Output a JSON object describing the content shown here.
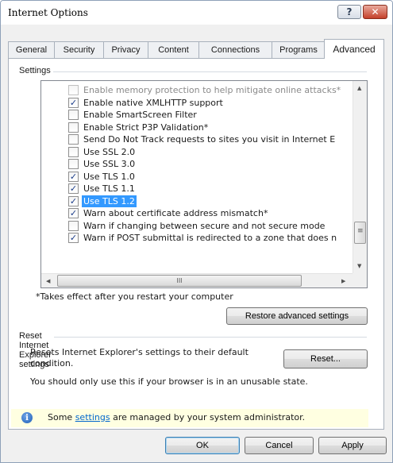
{
  "window": {
    "title": "Internet Options",
    "help_glyph": "?",
    "close_glyph": "✕"
  },
  "tabs": [
    {
      "label": "General"
    },
    {
      "label": "Security"
    },
    {
      "label": "Privacy"
    },
    {
      "label": "Content"
    },
    {
      "label": "Connections"
    },
    {
      "label": "Programs"
    },
    {
      "label": "Advanced"
    }
  ],
  "active_tab": "Advanced",
  "settings": {
    "group_title": "Settings",
    "items": [
      {
        "label": "Enable memory protection to help mitigate online attacks*",
        "checked": false,
        "disabled": true
      },
      {
        "label": "Enable native XMLHTTP support",
        "checked": true,
        "disabled": false
      },
      {
        "label": "Enable SmartScreen Filter",
        "checked": false,
        "disabled": false
      },
      {
        "label": "Enable Strict P3P Validation*",
        "checked": false,
        "disabled": false
      },
      {
        "label": "Send Do Not Track requests to sites you visit in Internet E",
        "checked": false,
        "disabled": false
      },
      {
        "label": "Use SSL 2.0",
        "checked": false,
        "disabled": false
      },
      {
        "label": "Use SSL 3.0",
        "checked": false,
        "disabled": false
      },
      {
        "label": "Use TLS 1.0",
        "checked": true,
        "disabled": false
      },
      {
        "label": "Use TLS 1.1",
        "checked": true,
        "disabled": false
      },
      {
        "label": "Use TLS 1.2",
        "checked": true,
        "disabled": false,
        "selected": true
      },
      {
        "label": "Warn about certificate address mismatch*",
        "checked": true,
        "disabled": false
      },
      {
        "label": "Warn if changing between secure and not secure mode",
        "checked": false,
        "disabled": false
      },
      {
        "label": "Warn if POST submittal is redirected to a zone that does n",
        "checked": true,
        "disabled": false
      }
    ],
    "check_glyph": "✓",
    "footnote": "*Takes effect after you restart your computer",
    "restore_button": "Restore advanced settings"
  },
  "reset": {
    "group_title": "Reset Internet Explorer settings",
    "description_line1": "Resets Internet Explorer's settings to their default",
    "description_line2": "condition.",
    "button": "Reset...",
    "note": "You should only use this if your browser is in an unusable state."
  },
  "notice": {
    "prefix": "Some ",
    "link": "settings",
    "suffix": " are managed by your system administrator."
  },
  "scroll_glyphs": {
    "up": "▲",
    "down": "▼",
    "left": "◀",
    "right": "▶",
    "grip": "III",
    "vgrip": "≡"
  },
  "footer_buttons": {
    "ok": "OK",
    "cancel": "Cancel",
    "apply": "Apply"
  }
}
